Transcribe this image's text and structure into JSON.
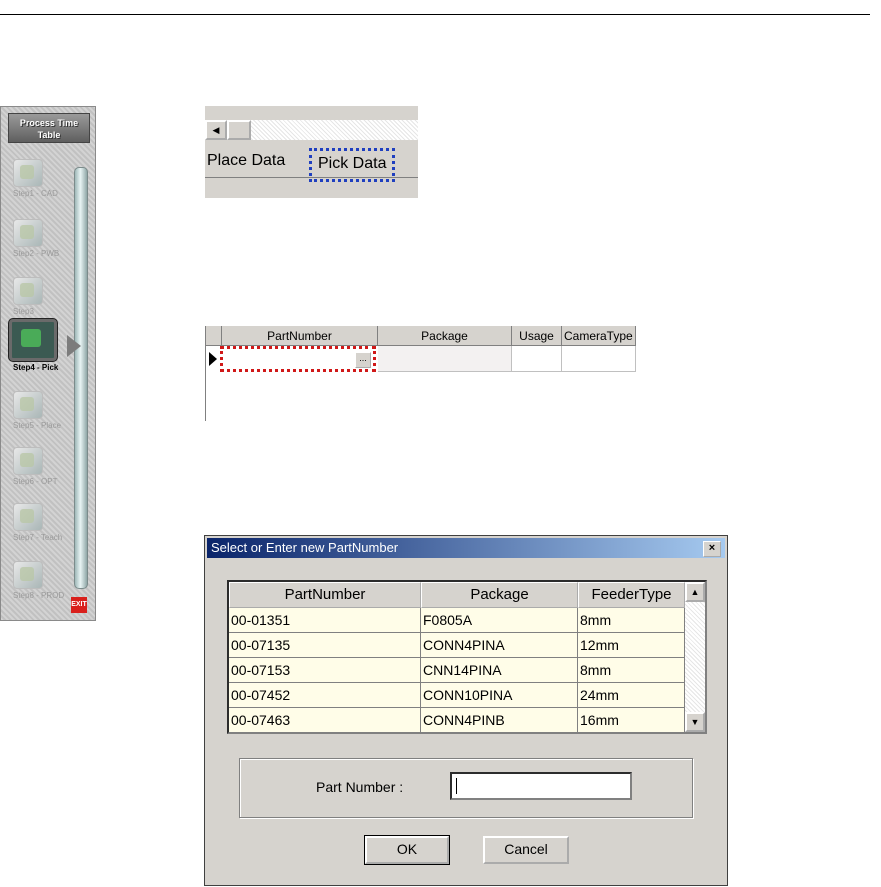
{
  "panel": {
    "title": "Process Time Table",
    "steps": [
      {
        "label": "Step1 - CAD",
        "active": false
      },
      {
        "label": "Step2 - PWB",
        "active": false
      },
      {
        "label": "Step3",
        "active": false
      },
      {
        "label": "Step4 - Pick",
        "active": true
      },
      {
        "label": "Step5 - Place",
        "active": false
      },
      {
        "label": "Step6 - OPT",
        "active": false
      },
      {
        "label": "Step7 - Teach",
        "active": false
      },
      {
        "label": "Step8 - PROD",
        "active": false
      }
    ],
    "exit_label": "EXIT"
  },
  "tabs": {
    "items": [
      "Place Data",
      "Pick Data"
    ],
    "selected": "Pick Data"
  },
  "grid": {
    "columns": [
      "PartNumber",
      "Package",
      "Usage",
      "CameraType"
    ],
    "ellipsis": "..."
  },
  "dialog": {
    "title": "Select or Enter new PartNumber",
    "close": "×",
    "columns": [
      "PartNumber",
      "Package",
      "FeederType"
    ],
    "rows": [
      [
        "00-01351",
        "F0805A",
        "8mm"
      ],
      [
        "00-07135",
        "CONN4PINA",
        "12mm"
      ],
      [
        "00-07153",
        "CNN14PINA",
        "8mm"
      ],
      [
        "00-07452",
        "CONN10PINA",
        "24mm"
      ],
      [
        "00-07463",
        "CONN4PINB",
        "16mm"
      ]
    ],
    "part_number_label": "Part Number :",
    "part_number_value": "",
    "ok": "OK",
    "cancel": "Cancel"
  }
}
